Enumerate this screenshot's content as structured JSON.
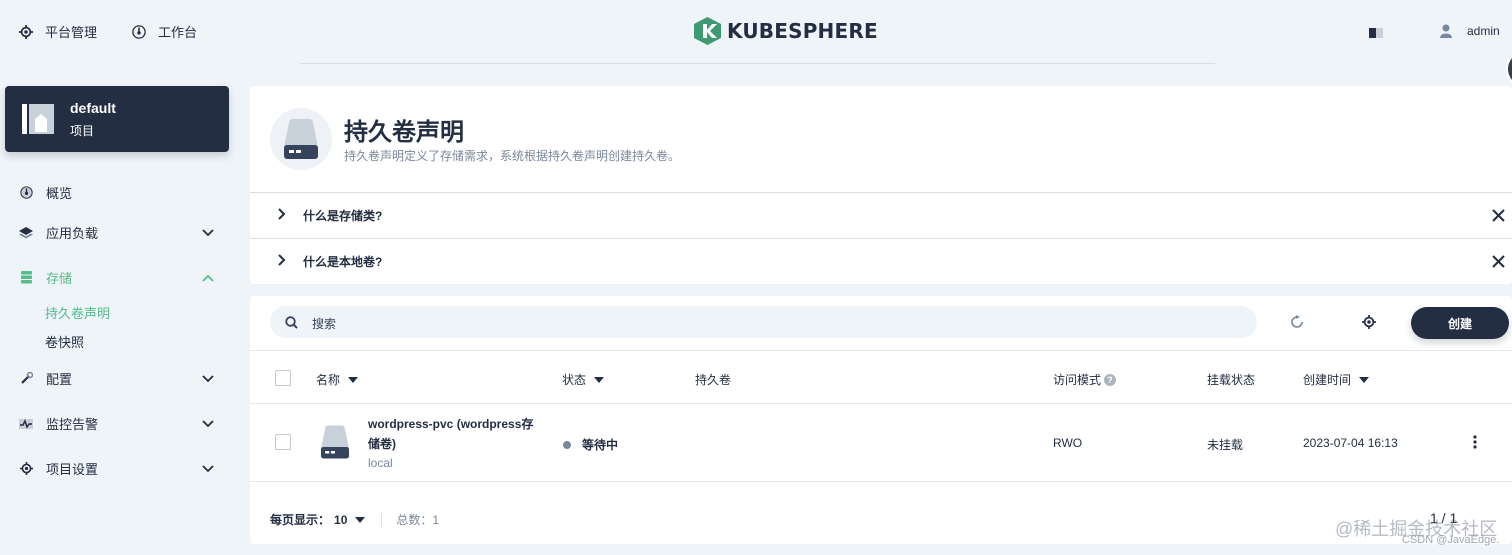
{
  "topnav": {
    "platform": "平台管理",
    "workbench": "工作台",
    "logo": "KUBESPHERE",
    "user": "admin"
  },
  "project": {
    "name": "default",
    "type": "项目"
  },
  "sidebar": {
    "items": [
      {
        "label": "概览"
      },
      {
        "label": "应用负载"
      },
      {
        "label": "存储"
      },
      {
        "label": "配置"
      },
      {
        "label": "监控告警"
      },
      {
        "label": "项目设置"
      }
    ],
    "storage_sub": [
      "持久卷声明",
      "卷快照"
    ]
  },
  "header": {
    "title": "持久卷声明",
    "description": "持久卷声明定义了存储需求，系统根据持久卷声明创建持久卷。",
    "tips": [
      "什么是存储类?",
      "什么是本地卷?"
    ]
  },
  "toolbar": {
    "search_placeholder": "搜索",
    "create_label": "创建"
  },
  "table": {
    "columns": [
      "名称",
      "状态",
      "持久卷",
      "访问模式",
      "挂载状态",
      "创建时间"
    ],
    "rows": [
      {
        "name": "wordpress-pvc (wordpress存储卷)",
        "name_line1": "wordpress-pvc (wordpress存",
        "name_line2": "储卷)",
        "storage_class": "local",
        "status": "等待中",
        "volume": "",
        "access_mode": "RWO",
        "mount_status": "未挂载",
        "created": "2023-07-04 16:13"
      }
    ]
  },
  "footer": {
    "per_page_label": "每页显示：",
    "per_page": "10",
    "total_label": "总数：",
    "total": "1",
    "page": "1 / 1"
  },
  "watermark": {
    "line1": "@稀土掘金技术社区",
    "line2": "CSDN @JavaEdge."
  },
  "colors": {
    "accent": "#55bc8a",
    "dark": "#242e42",
    "muted": "#79879c",
    "background": "#eff4f9"
  }
}
